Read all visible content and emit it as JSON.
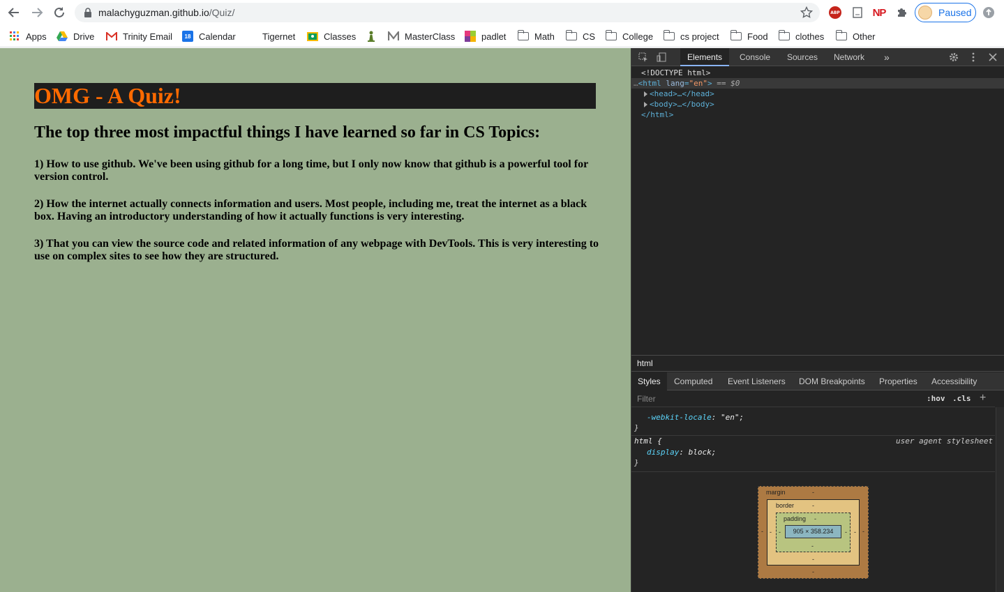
{
  "browser": {
    "url_host": "malachyguzman.github.io",
    "url_path": "/Quiz/",
    "profile_label": "Paused",
    "ext_abp": "ABP",
    "ext_np": "NP"
  },
  "bookmarks": [
    {
      "label": "Apps",
      "icon": "apps-grid-icon"
    },
    {
      "label": "Drive",
      "icon": "drive-icon"
    },
    {
      "label": "Trinity Email",
      "icon": "gmail-icon"
    },
    {
      "label": "Calendar",
      "icon": "calendar-icon",
      "badge": "18"
    },
    {
      "label": "Tigernet",
      "icon": "tigernet-icon"
    },
    {
      "label": "Classes",
      "icon": "classroom-icon"
    },
    {
      "label": "",
      "icon": "chess-pawn-icon"
    },
    {
      "label": "MasterClass",
      "icon": "masterclass-icon"
    },
    {
      "label": "padlet",
      "icon": "padlet-icon"
    },
    {
      "label": "Math",
      "icon": "folder-icon"
    },
    {
      "label": "CS",
      "icon": "folder-icon"
    },
    {
      "label": "College",
      "icon": "folder-icon"
    },
    {
      "label": "cs project",
      "icon": "folder-icon"
    },
    {
      "label": "Food",
      "icon": "folder-icon"
    },
    {
      "label": "clothes",
      "icon": "folder-icon"
    },
    {
      "label": "Other",
      "icon": "folder-icon"
    }
  ],
  "page": {
    "title": "OMG - A Quiz!",
    "subtitle": "The top three most impactful things I have learned so far in CS Topics:",
    "items": [
      "1) How to use github. We've been using github for a long time, but I only now know that github is a powerful tool for version control.",
      "2) How the internet actually connects information and users. Most people, including me, treat the internet as a black box. Having an introductory understanding of how it actually functions is very interesting.",
      "3) That you can view the source code and related information of any webpage with DevTools. This is very interesting to use on complex sites to see how they are structured."
    ],
    "colors": {
      "background": "#9bb08f",
      "banner": "#1e1e1e",
      "title": "#ff6a00"
    }
  },
  "devtools": {
    "tabs": [
      "Elements",
      "Console",
      "Sources",
      "Network"
    ],
    "active_tab": "Elements",
    "more_tabs": "»",
    "dom": {
      "doctype": "<!DOCTYPE html>",
      "html_open_tag": "<html",
      "html_lang_attr": "lang",
      "html_lang_val": "\"en\"",
      "html_close": ">",
      "selected_marker": " == $0",
      "head": "<head>…</head>",
      "body": "<body>…</body>",
      "html_close_tag": "</html>"
    },
    "breadcrumb": "html",
    "sub_tabs": [
      "Styles",
      "Computed",
      "Event Listeners",
      "DOM Breakpoints",
      "Properties",
      "Accessibility"
    ],
    "active_sub_tab": "Styles",
    "filter_placeholder": "Filter",
    "hov": ":hov",
    "cls": ".cls",
    "styles": {
      "locale_prop": "-webkit-locale",
      "locale_val": "\"en\";",
      "close_brace": "}",
      "rule_selector": "html {",
      "rule_source": "user agent stylesheet",
      "display_prop": "display",
      "display_val": "block;"
    },
    "box_model": {
      "margin_label": "margin",
      "border_label": "border",
      "padding_label": "padding",
      "dash": "-",
      "content_size": "905 × 358.234"
    }
  }
}
